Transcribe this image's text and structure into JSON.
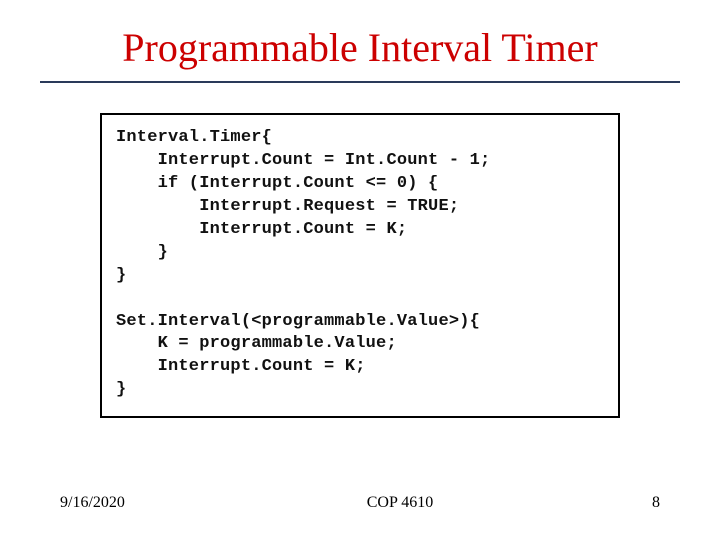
{
  "title": "Programmable Interval Timer",
  "code": "Interval.Timer{\n    Interrupt.Count = Int.Count - 1;\n    if (Interrupt.Count <= 0) {\n        Interrupt.Request = TRUE;\n        Interrupt.Count = K;\n    }\n}\n\nSet.Interval(<programmable.Value>){\n    K = programmable.Value;\n    Interrupt.Count = K;\n}",
  "footer": {
    "date": "9/16/2020",
    "course": "COP 4610",
    "page": "8"
  }
}
